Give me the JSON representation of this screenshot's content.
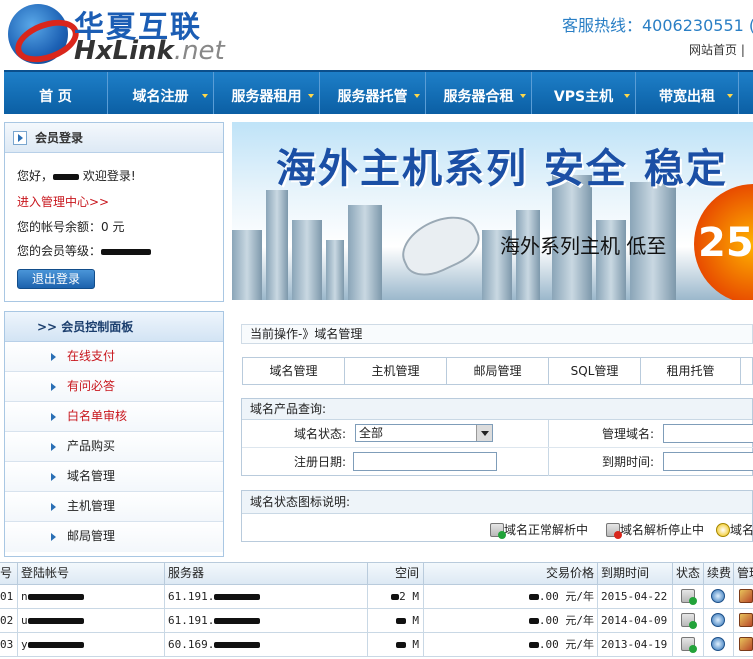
{
  "header": {
    "logo_cn": "华夏互联",
    "logo_en": "HxLink",
    "logo_en_suffix": ".net",
    "hotline": "客服热线：4006230551  (",
    "home_link": "网站首页  |"
  },
  "nav": {
    "items": [
      {
        "label": "首 页",
        "dropdown": false
      },
      {
        "label": "域名注册",
        "dropdown": true
      },
      {
        "label": "服务器租用",
        "dropdown": true
      },
      {
        "label": "服务器托管",
        "dropdown": true
      },
      {
        "label": "服务器合租",
        "dropdown": true
      },
      {
        "label": "VPS主机",
        "dropdown": true
      },
      {
        "label": "带宽出租",
        "dropdown": true
      }
    ]
  },
  "login": {
    "title": "会员登录",
    "greeting_prefix": "您好，",
    "greeting_suffix": " 欢迎登录!",
    "manage_link": "进入管理中心>>",
    "balance": "您的帐号余额：0 元",
    "level_label": "您的会员等级：",
    "logout": "退出登录"
  },
  "banner": {
    "title": "海外主机系列 安全 稳定",
    "subtitle": "海外系列主机 低至",
    "price": "25"
  },
  "control_panel": {
    "title": ">> 会员控制面板",
    "items": [
      {
        "label": "在线支付",
        "highlight": true
      },
      {
        "label": "有问必答",
        "highlight": true
      },
      {
        "label": "白名单审核",
        "highlight": true
      },
      {
        "label": "产品购买",
        "highlight": false
      },
      {
        "label": "域名管理",
        "highlight": false
      },
      {
        "label": "主机管理",
        "highlight": false
      },
      {
        "label": "邮局管理",
        "highlight": false
      }
    ]
  },
  "current_op": "当前操作-》域名管理",
  "tabs": [
    "域名管理",
    "主机管理",
    "邮局管理",
    "SQL管理",
    "租用托管"
  ],
  "query": {
    "title": "域名产品查询:",
    "status_label": "域名状态:",
    "status_value": "全部",
    "manage_domain_label": "管理域名:",
    "reg_date_label": "注册日期:",
    "expire_label": "到期时间:"
  },
  "legend": {
    "title": "域名状态图标说明:",
    "items": [
      "域名正常解析中",
      "域名解析停止中",
      "域名"
    ]
  },
  "table": {
    "headers": [
      "号",
      "登陆帐号",
      "服务器",
      "空间",
      "交易价格",
      "到期时间",
      "状态",
      "续费",
      "管理"
    ],
    "rows": [
      {
        "no": "01",
        "account_prefix": "n",
        "server_prefix": "61.191.",
        "space": "2 M",
        "price": ".00 元/年",
        "expire": "2015-04-22"
      },
      {
        "no": "02",
        "account_prefix": "u",
        "server_prefix": "61.191.",
        "space": " M",
        "price": ".00 元/年",
        "expire": "2014-04-09"
      },
      {
        "no": "03",
        "account_prefix": "y",
        "server_prefix": "60.169.",
        "space": " M",
        "price": ".00 元/年",
        "expire": "2013-04-19"
      }
    ]
  },
  "colors": {
    "nav_blue": "#0b5fa4",
    "accent_red": "#c8161d",
    "link_blue": "#2a7fc5"
  }
}
